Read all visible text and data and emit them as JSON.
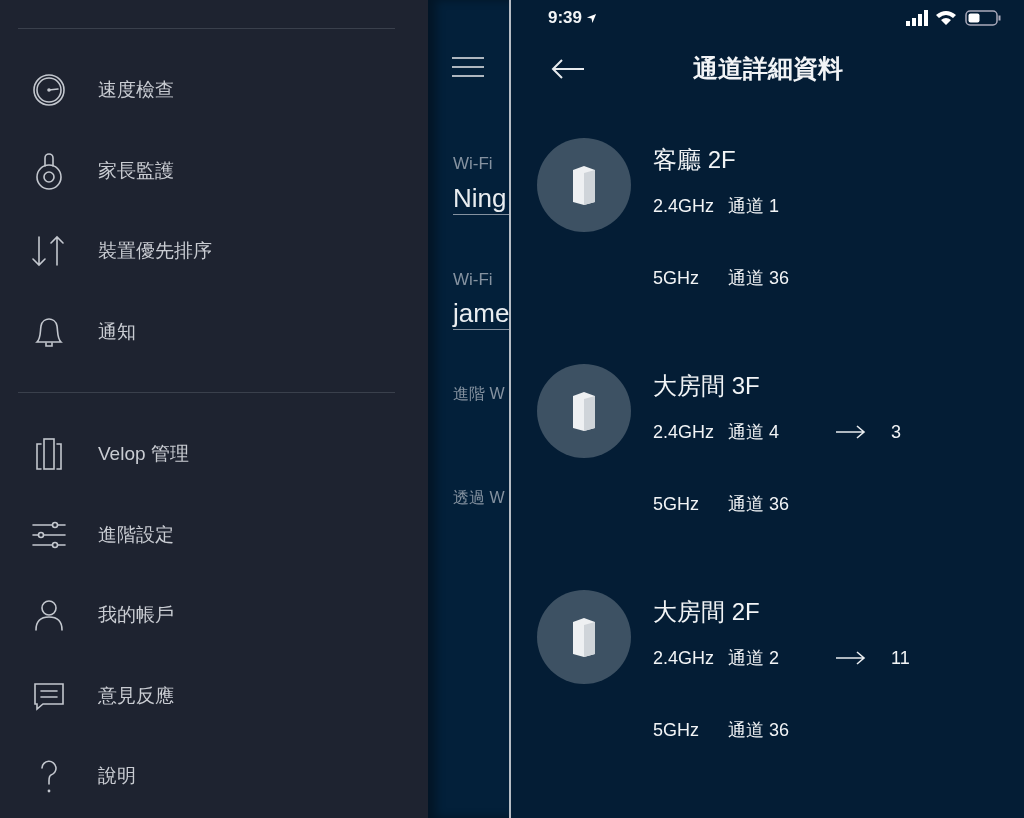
{
  "menu": {
    "sections": [
      {
        "items": [
          {
            "label": "速度檢查"
          },
          {
            "label": "家長監護"
          },
          {
            "label": "裝置優先排序"
          },
          {
            "label": "通知"
          }
        ]
      },
      {
        "items": [
          {
            "label": "Velop 管理"
          },
          {
            "label": "進階設定"
          },
          {
            "label": "我的帳戶"
          },
          {
            "label": "意見反應"
          },
          {
            "label": "說明"
          }
        ]
      }
    ]
  },
  "background_screen": {
    "texts": [
      {
        "kind": "label",
        "text": "Wi-Fi"
      },
      {
        "kind": "value",
        "text": "Ning"
      },
      {
        "kind": "label",
        "text": "Wi-Fi"
      },
      {
        "kind": "value",
        "text": "jame"
      },
      {
        "kind": "link",
        "text": "進階 W"
      },
      {
        "kind": "link",
        "text": "透過 W"
      }
    ]
  },
  "status_bar": {
    "time": "9:39"
  },
  "header": {
    "title": "通道詳細資料"
  },
  "nodes": [
    {
      "name": "客廳 2F",
      "channels": [
        {
          "band": "2.4GHz",
          "channel": "通道 1"
        },
        {
          "band": "5GHz",
          "channel": "通道 36"
        }
      ]
    },
    {
      "name": "大房間 3F",
      "channels": [
        {
          "band": "2.4GHz",
          "channel": "通道 4",
          "new_channel": "3"
        },
        {
          "band": "5GHz",
          "channel": "通道 36"
        }
      ]
    },
    {
      "name": "大房間 2F",
      "channels": [
        {
          "band": "2.4GHz",
          "channel": "通道 2",
          "new_channel": "11"
        },
        {
          "band": "5GHz",
          "channel": "通道 36"
        }
      ]
    }
  ]
}
